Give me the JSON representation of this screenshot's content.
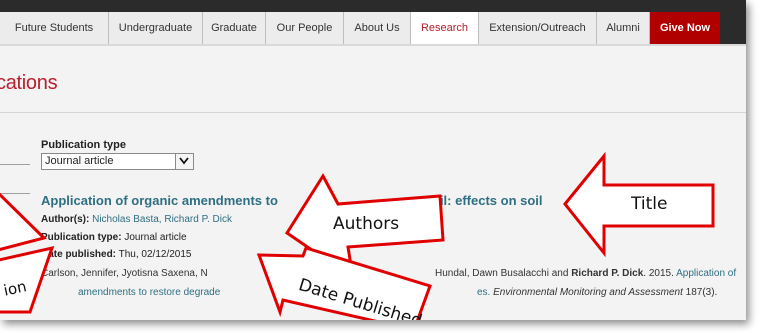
{
  "nav": {
    "tabs": [
      {
        "label": "Future Students"
      },
      {
        "label": "Undergraduate"
      },
      {
        "label": "Graduate"
      },
      {
        "label": "Our People"
      },
      {
        "label": "About Us"
      },
      {
        "label": "Research"
      },
      {
        "label": "Extension/Outreach"
      },
      {
        "label": "Alumni"
      },
      {
        "label": "Give Now"
      }
    ],
    "active_tab": "Research",
    "colors": {
      "bar": "#2b2b2b",
      "give_now": "#b00000",
      "active_text": "#b7202e"
    }
  },
  "page": {
    "title_fragment": "cations"
  },
  "filter": {
    "label": "Publication type",
    "value": "Journal article"
  },
  "publication": {
    "title": "Application of organic amendments to",
    "title_tail": "oil: effects on soil",
    "authors_label": "Author(s):",
    "authors": "Nicholas Basta, Richard P. Dick",
    "type_label": "Publication type:",
    "type": "Journal article",
    "date_label": "Date published:",
    "date": "Thu, 02/12/2015",
    "citation_line1_start": "Carlson, Jennifer, Jyotisna Saxena, N",
    "citation_line1_mid": "Hundal, Dawn Busalacchi and",
    "citation_line1_bold": "Richard P. Dick",
    "citation_line1_year": ". 2015.",
    "citation_line1_link": "Application of",
    "citation_line2_link_a": "amendments to restore degrade",
    "citation_line2_link_b": "es.",
    "citation_line2_journal": "Environmental Monitoring and Assessment",
    "citation_line2_issue": "187(3)."
  },
  "callouts": {
    "title": "Title",
    "authors": "Authors",
    "date_published": "Date Published",
    "publication_fragment": "ion",
    "color": "#e00000"
  }
}
